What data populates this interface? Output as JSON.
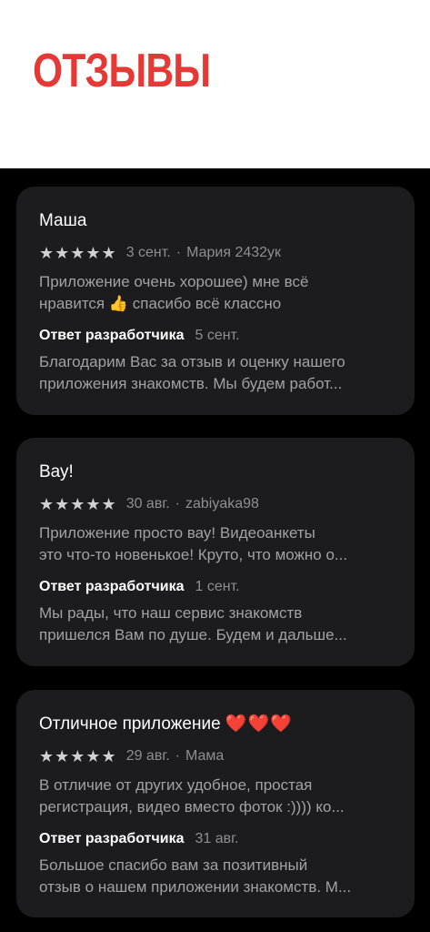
{
  "header": {
    "title": "ОТЗЫВЫ"
  },
  "reviews": [
    {
      "title": "Маша",
      "stars": "★★★★★",
      "date": "3 сент.",
      "separator": "·",
      "author": "Мария 2432ук",
      "body_lines": [
        "Приложение очень хорошее) мне всё",
        "нравится",
        "спасибо всё классно"
      ],
      "emoji": "👍",
      "response_label": "Ответ разработчика",
      "response_date": "5 сент.",
      "response_lines": [
        "Благодарим Вас за отзыв и оценку нашего",
        "приложения знакомств. Мы будем работ..."
      ]
    },
    {
      "title": "Вау!",
      "stars": "★★★★★",
      "date": "30 авг.",
      "separator": "·",
      "author": "zabiyaka98",
      "body_lines": [
        "Приложение просто вау! Видеоанкеты",
        "это что-то новенькое! Круто, что можно о..."
      ],
      "response_label": "Ответ разработчика",
      "response_date": "1 сент.",
      "response_lines": [
        "Мы рады, что наш сервис знакомств",
        "пришелся Вам по душе. Будем и дальше..."
      ]
    },
    {
      "title": "Отличное приложение",
      "hearts": "❤️❤️❤️",
      "stars": "★★★★★",
      "date": "29 авг.",
      "separator": "·",
      "author": "Мама",
      "body_lines": [
        "В отличие от других удобное, простая",
        "регистрация, видео вместо фоток :)))) ко..."
      ],
      "response_label": "Ответ разработчика",
      "response_date": "31 авг.",
      "response_lines": [
        "Большое спасибо вам за позитивный",
        "отзыв о нашем приложении знакомств. М..."
      ]
    }
  ]
}
